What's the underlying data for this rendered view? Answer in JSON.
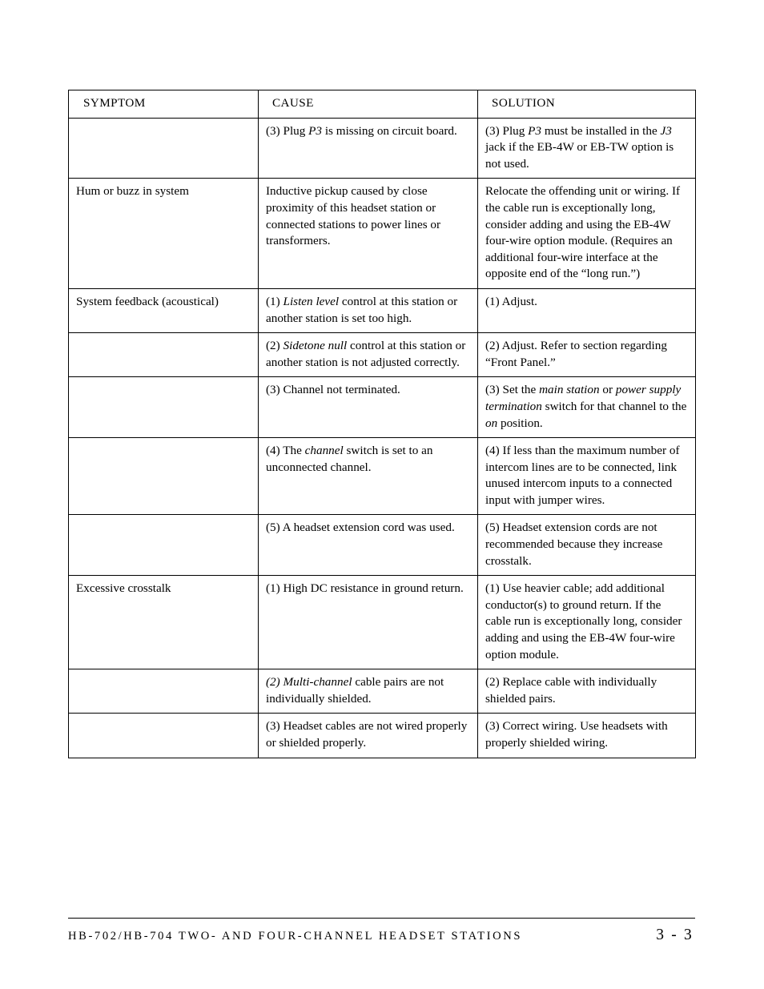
{
  "document": {
    "page_number": "3 - 3",
    "footer_title": "HB-702/HB-704 TWO- AND FOUR-CHANNEL HEADSET STATIONS"
  },
  "table": {
    "headers": {
      "symptom": "SYMPTOM",
      "cause": "CAUSE",
      "solution": "SOLUTION"
    },
    "rows": [
      {
        "symptom": "",
        "cause_html": "(3) Plug <i>P3</i> is missing on circuit board.",
        "solution_html": "(3) Plug <i>P3</i> must be installed in the <i>J3</i> jack if the EB-4W or EB-TW option is not used."
      },
      {
        "symptom": "Hum or buzz in system",
        "cause_html": "Inductive pickup caused by close proximity of this headset station or connected stations to power lines or transformers.",
        "solution_html": "Relocate the offending unit or wiring. If the cable run is exceptionally long, consider adding and using the EB-4W four-wire option module. (Requires an additional four-wire interface at the opposite end of the &ldquo;long run.&rdquo;)"
      },
      {
        "symptom": "System feedback (acoustical)",
        "cause_html": "(1) <i>Listen level</i> control at this station or another station is set too high.",
        "solution_html": "(1) Adjust."
      },
      {
        "symptom": "",
        "cause_html": "(2) <i>Sidetone null</i> control at this station or another station is not adjusted correctly.",
        "solution_html": "(2) Adjust. Refer to section regarding &ldquo;Front Panel.&rdquo;"
      },
      {
        "symptom": "",
        "cause_html": "(3) Channel not terminated.",
        "solution_html": "(3) Set the <i>main station</i> or <i>power supply termination</i> switch for that channel to the <i>on</i> position."
      },
      {
        "symptom": "",
        "cause_html": "(4) The <i>channel</i> switch is set to an unconnected channel.",
        "solution_html": "(4) If less than the maximum number of intercom lines are to be connected, link unused intercom inputs to a connected input with jumper wires."
      },
      {
        "symptom": "",
        "cause_html": "(5) A headset extension cord was used.",
        "solution_html": "(5) Headset extension cords are not recommended because they increase crosstalk."
      },
      {
        "symptom": "Excessive crosstalk",
        "cause_html": "(1) High DC resistance in ground return.",
        "solution_html": "(1) Use heavier cable; add additional conductor(s) to ground return. If the cable run is exceptionally long, consider adding and using the EB-4W four-wire option module."
      },
      {
        "symptom": "",
        "cause_html": "<i>(2) Multi-channel</i> cable pairs are not individually shielded.",
        "solution_html": "(2) Replace cable with individually shielded pairs."
      },
      {
        "symptom": "",
        "cause_html": "(3) Headset cables are not wired properly or shielded properly.",
        "solution_html": "(3) Correct wiring. Use headsets with properly shielded wiring."
      }
    ]
  },
  "colors": {
    "text": "#000000",
    "rule": "#000000",
    "background": "#ffffff"
  }
}
